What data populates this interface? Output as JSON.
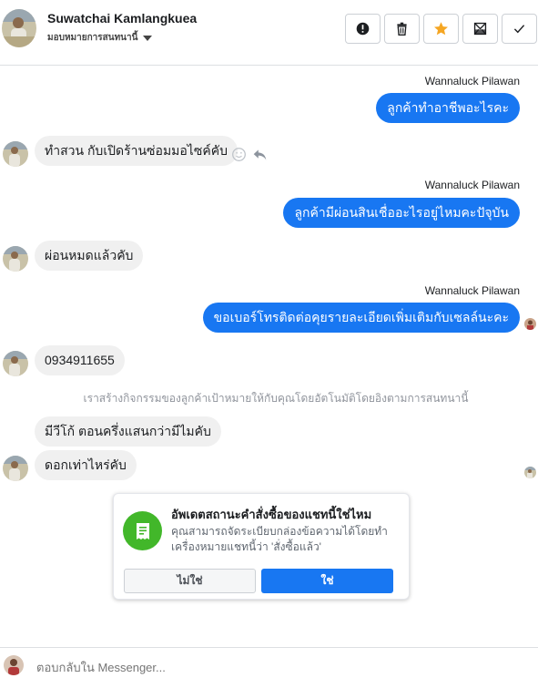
{
  "header": {
    "contact_name": "Suwatchai Kamlangkuea",
    "label_selector": "มอบหมายการสนทนานี้"
  },
  "toolbar": {
    "buttons": [
      {
        "icon": "alert-circle-icon",
        "label": "Report"
      },
      {
        "icon": "trash-icon",
        "label": "Delete"
      },
      {
        "icon": "star-icon",
        "label": "Star",
        "color": "#f5a623"
      },
      {
        "icon": "mark-unread-icon",
        "label": "Mark as unread"
      },
      {
        "icon": "checkmark-icon",
        "label": "Mark as done"
      }
    ]
  },
  "messages": [
    {
      "direction": "out",
      "sender": "Wannaluck Pilawan",
      "text": "ลูกค้าทำอาชีพอะไรคะ"
    },
    {
      "direction": "in",
      "text": "ทำสวน กับเปิดร้านซ่อมมอไซค์คับ"
    },
    {
      "direction": "out",
      "sender": "Wannaluck Pilawan",
      "text": "ลูกค้ามีผ่อนสินเชื่ออะไรอยู่ไหมคะปัจุบัน"
    },
    {
      "direction": "in",
      "text": "ผ่อนหมดแล้วคับ"
    },
    {
      "direction": "out",
      "sender": "Wannaluck Pilawan",
      "text": "ขอเบอร์โทรติดต่อคุยรายละเอียดเพิ่มเติมกับเซลล์นะคะ"
    },
    {
      "direction": "in",
      "text": "0934911655"
    },
    {
      "direction": "in",
      "text": "มีวีโก้ ตอนครึ่งแสนกว่ามีไมคับ"
    },
    {
      "direction": "in",
      "text": "ดอกเท่าไหร่คับ"
    }
  ],
  "system_note": "เราสร้างกิจกรรมของลูกค้าเป้าหมายให้กับคุณโดยอัตโนมัติโดยอิงตามการสนทนานี้",
  "order_card": {
    "title": "อัพเดตสถานะคำสั่งซื้อของแชทนี้ใช่ไหม",
    "body": "คุณสามารถจัดระเบียบกล่องข้อความได้โดยทำเครื่องหมายแชทนี้ว่า 'สั่งซื้อแล้ว'",
    "no_label": "ไม่ใช่",
    "yes_label": "ใช่",
    "accent": "#42b72a"
  },
  "composer": {
    "placeholder": "ตอบกลับใน Messenger..."
  },
  "colors": {
    "outgoing_bubble": "#1877f2",
    "incoming_bubble": "#f0f0f0"
  }
}
